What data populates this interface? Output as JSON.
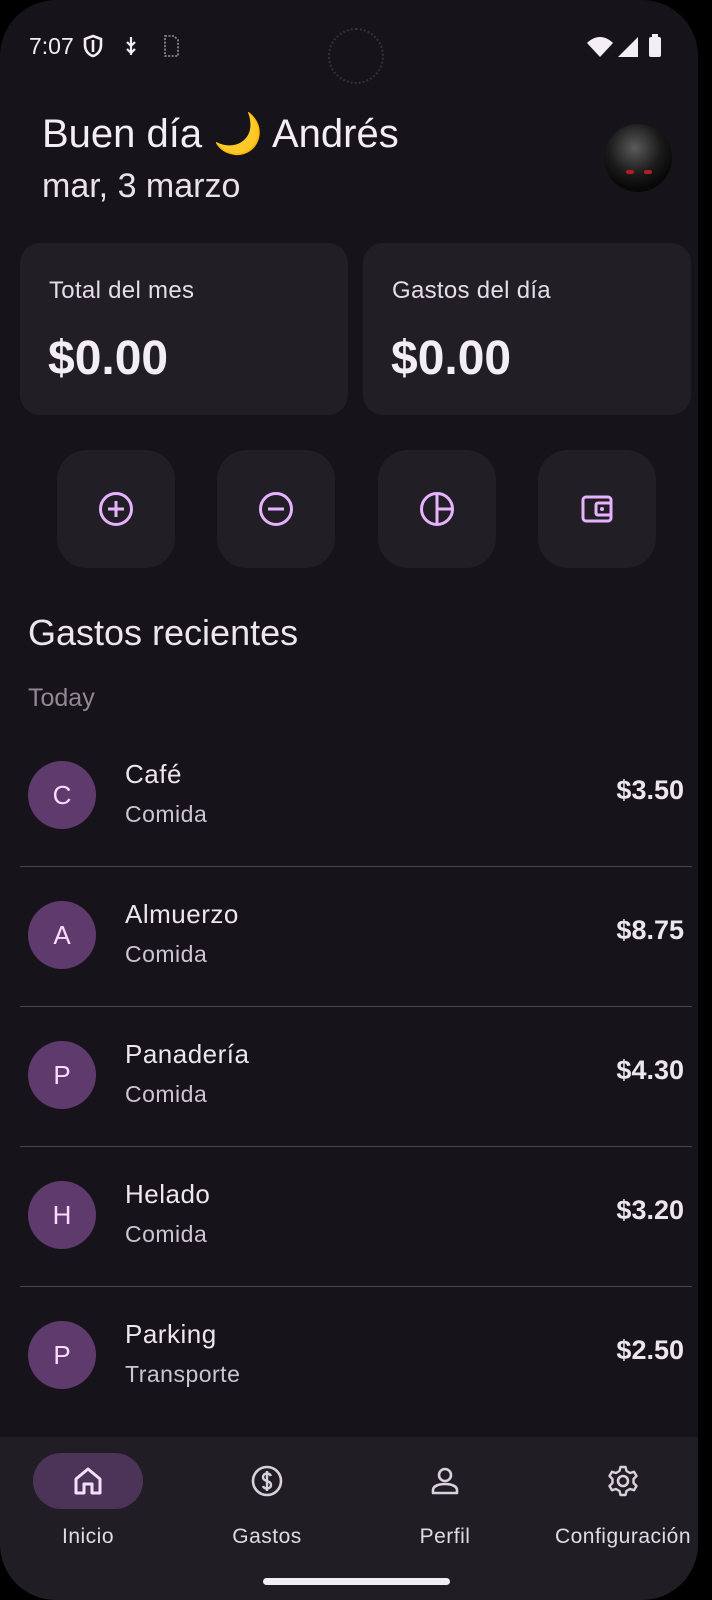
{
  "status_bar": {
    "time": "7:07",
    "icons": [
      "shield-icon",
      "usb-debug-icon",
      "sim-card-icon",
      "wifi-icon",
      "signal-icon",
      "battery-icon"
    ]
  },
  "header": {
    "greeting": "Buen día",
    "greeting_emoji": "🌙",
    "user_name": "Andrés",
    "date": "mar, 3 marzo",
    "avatar_icon": "profile-avatar"
  },
  "summary": {
    "month_label": "Total del mes",
    "month_value": "$0.00",
    "day_label": "Gastos del día",
    "day_value": "$0.00"
  },
  "quick_actions": [
    {
      "icon": "add-circle-icon"
    },
    {
      "icon": "remove-circle-icon"
    },
    {
      "icon": "pie-chart-icon"
    },
    {
      "icon": "wallet-icon"
    }
  ],
  "recent": {
    "title": "Gastos recientes",
    "group_label": "Today",
    "items": [
      {
        "initial": "C",
        "name": "Café",
        "category": "Comida",
        "amount": "$3.50"
      },
      {
        "initial": "A",
        "name": "Almuerzo",
        "category": "Comida",
        "amount": "$8.75"
      },
      {
        "initial": "P",
        "name": "Panadería",
        "category": "Comida",
        "amount": "$4.30"
      },
      {
        "initial": "H",
        "name": "Helado",
        "category": "Comida",
        "amount": "$3.20"
      },
      {
        "initial": "P",
        "name": "Parking",
        "category": "Transporte",
        "amount": "$2.50"
      }
    ]
  },
  "nav": {
    "items": [
      {
        "label": "Inicio",
        "icon": "home-icon",
        "active": true
      },
      {
        "label": "Gastos",
        "icon": "dollar-circle-icon",
        "active": false
      },
      {
        "label": "Perfil",
        "icon": "person-icon",
        "active": false
      },
      {
        "label": "Configuración",
        "icon": "gear-icon",
        "active": false
      }
    ]
  },
  "colors": {
    "background": "#17131a",
    "card": "#221e25",
    "accent": "#e7b3ff",
    "avatar_circle": "#5f3a6d",
    "nav_active_pill": "#4b3457"
  }
}
